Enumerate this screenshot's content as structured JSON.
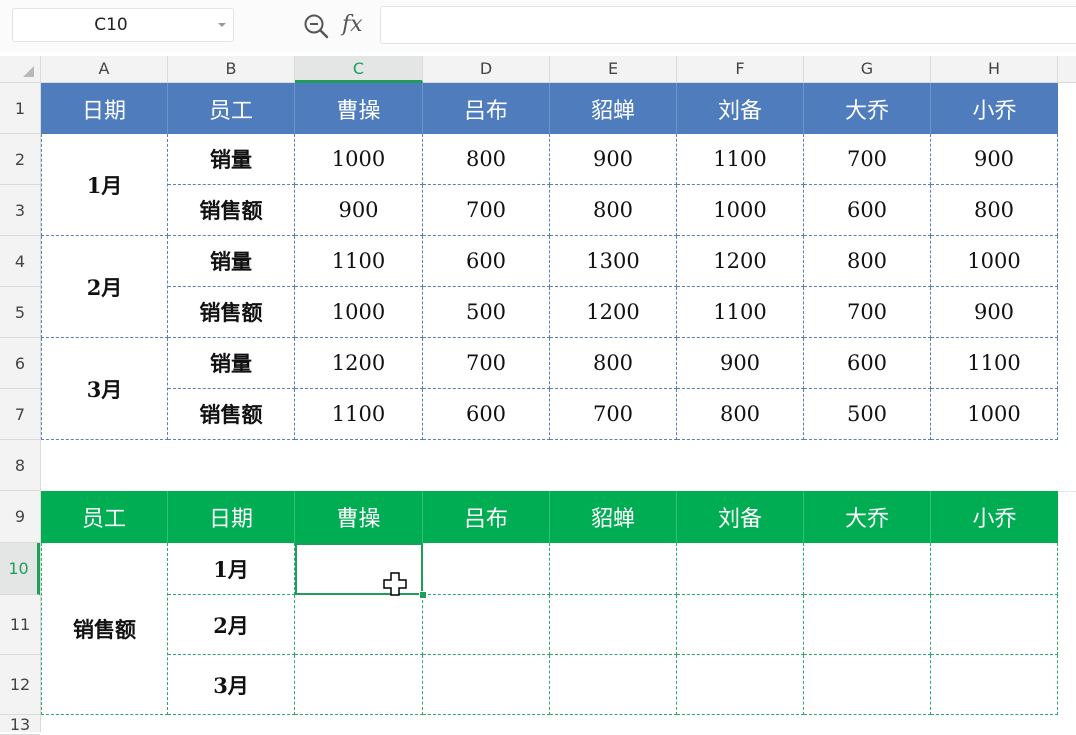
{
  "formula_bar": {
    "name_box": "C10",
    "fx_label": "fx",
    "formula_value": ""
  },
  "columns": [
    "A",
    "B",
    "C",
    "D",
    "E",
    "F",
    "G",
    "H"
  ],
  "rows": [
    "1",
    "2",
    "3",
    "4",
    "5",
    "6",
    "7",
    "8",
    "9",
    "10",
    "11",
    "12",
    "13"
  ],
  "active_cell": "C10",
  "table1": {
    "header": [
      "日期",
      "员工",
      "曹操",
      "吕布",
      "貂蝉",
      "刘备",
      "大乔",
      "小乔"
    ],
    "months": [
      "1月",
      "2月",
      "3月"
    ],
    "metrics": [
      "销量",
      "销售额"
    ],
    "values": [
      [
        "1000",
        "800",
        "900",
        "1100",
        "700",
        "900"
      ],
      [
        "900",
        "700",
        "800",
        "1000",
        "600",
        "800"
      ],
      [
        "1100",
        "600",
        "1300",
        "1200",
        "800",
        "1000"
      ],
      [
        "1000",
        "500",
        "1200",
        "1100",
        "700",
        "900"
      ],
      [
        "1200",
        "700",
        "800",
        "900",
        "600",
        "1100"
      ],
      [
        "1100",
        "600",
        "700",
        "800",
        "500",
        "1000"
      ]
    ]
  },
  "table2": {
    "header": [
      "员工",
      "日期",
      "曹操",
      "吕布",
      "貂蝉",
      "刘备",
      "大乔",
      "小乔"
    ],
    "metric": "销售额",
    "months": [
      "1月",
      "2月",
      "3月"
    ]
  },
  "colors": {
    "table1_header": "#4f7cbd",
    "table2_header": "#00ad52",
    "selection": "#1f9e5b"
  },
  "icons": [
    "zoom-icon",
    "fx-icon",
    "dropdown-arrow-icon",
    "crosshair-cursor-icon"
  ]
}
